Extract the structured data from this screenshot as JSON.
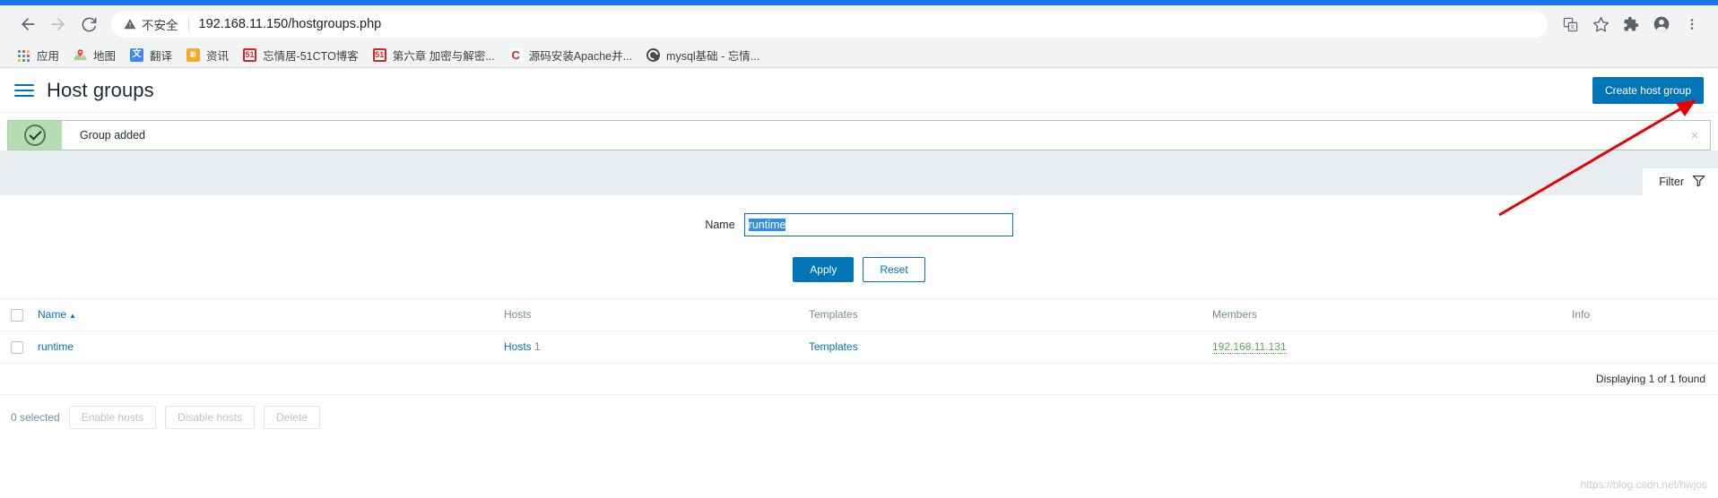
{
  "browser": {
    "nav": {
      "back": "back-arrow",
      "forward": "forward-arrow",
      "reload": "reload"
    },
    "omnibox": {
      "security_label": "不安全",
      "url": "192.168.11.150/hostgroups.php"
    },
    "toolbar_icons": [
      "translate-icon",
      "bookmark-star-icon",
      "extensions-icon",
      "profile-icon",
      "menu-icon"
    ],
    "bookmarks": [
      {
        "label": "应用",
        "icon": "apps-grid-icon"
      },
      {
        "label": "地图",
        "icon": "maps-pin-icon"
      },
      {
        "label": "翻译",
        "icon": "translate-icon"
      },
      {
        "label": "资讯",
        "icon": "news-icon"
      },
      {
        "label": "忘情居-51CTO博客",
        "icon": "51cto-icon"
      },
      {
        "label": "第六章 加密与解密...",
        "icon": "51cto-icon"
      },
      {
        "label": "源码安装Apache并...",
        "icon": "csdn-icon"
      },
      {
        "label": "mysql基础 - 忘情...",
        "icon": "globe-icon"
      }
    ]
  },
  "page": {
    "title": "Host groups",
    "create_button": "Create host group",
    "message": {
      "text": "Group added",
      "icon": "check-circle-icon",
      "close": "×",
      "color": "#b5dcb5"
    },
    "filter": {
      "tab_label": "Filter",
      "tab_icon": "funnel-icon",
      "name_label": "Name",
      "name_value": "runtime",
      "apply_label": "Apply",
      "reset_label": "Reset"
    },
    "table": {
      "columns": [
        "Name",
        "Hosts",
        "Templates",
        "Members",
        "Info"
      ],
      "sort_column": "Name",
      "sort_direction": "▲",
      "rows": [
        {
          "name": "runtime",
          "hosts_label": "Hosts",
          "hosts_count": "1",
          "templates_label": "Templates",
          "members": "192.168.11.131",
          "info": ""
        }
      ],
      "paging": "Displaying 1 of 1 found"
    },
    "footer": {
      "selected": "0 selected",
      "buttons": [
        "Enable hosts",
        "Disable hosts",
        "Delete"
      ]
    },
    "watermark": "https://blog.csdn.net/hwjos",
    "accent_color": "#0275b8"
  }
}
